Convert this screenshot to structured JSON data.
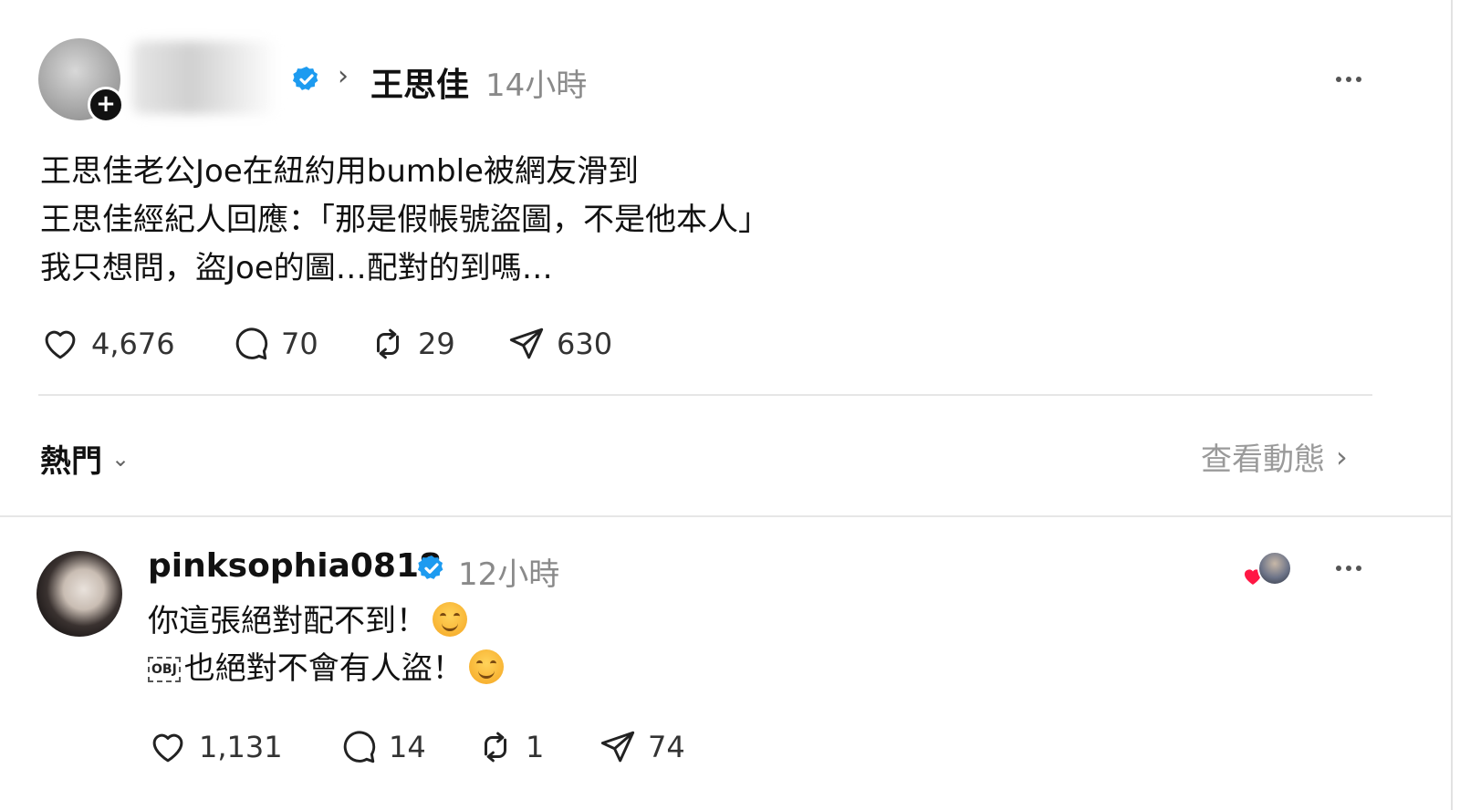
{
  "post": {
    "author": "王思佳",
    "time": "14小時",
    "text_lines": [
      "王思佳老公Joe在紐約用bumble被網友滑到",
      "王思佳經紀人回應：「那是假帳號盜圖，不是他本人」",
      "我只想問，盜Joe的圖…配對的到嗎…"
    ],
    "stats": {
      "likes": "4,676",
      "comments": "70",
      "reposts": "29",
      "shares": "630"
    }
  },
  "sort": {
    "label": "熱門"
  },
  "activity": {
    "label": "查看動態"
  },
  "reply": {
    "author": "pinksophia0818",
    "time": "12小時",
    "line1": "你這張絕對配不到！",
    "line2": "也絕對不會有人盜！",
    "obj_marker": "OBJ",
    "stats": {
      "likes": "1,131",
      "comments": "14",
      "reposts": "1",
      "shares": "74"
    }
  },
  "colors": {
    "verified": "#1d9bf0",
    "heart_red": "#ff1744",
    "muted": "#8a8a8a"
  },
  "icons": [
    "heart-icon",
    "comment-icon",
    "repost-icon",
    "share-icon",
    "verified-icon",
    "more-icon",
    "chevron-right-icon",
    "chevron-down-icon"
  ]
}
